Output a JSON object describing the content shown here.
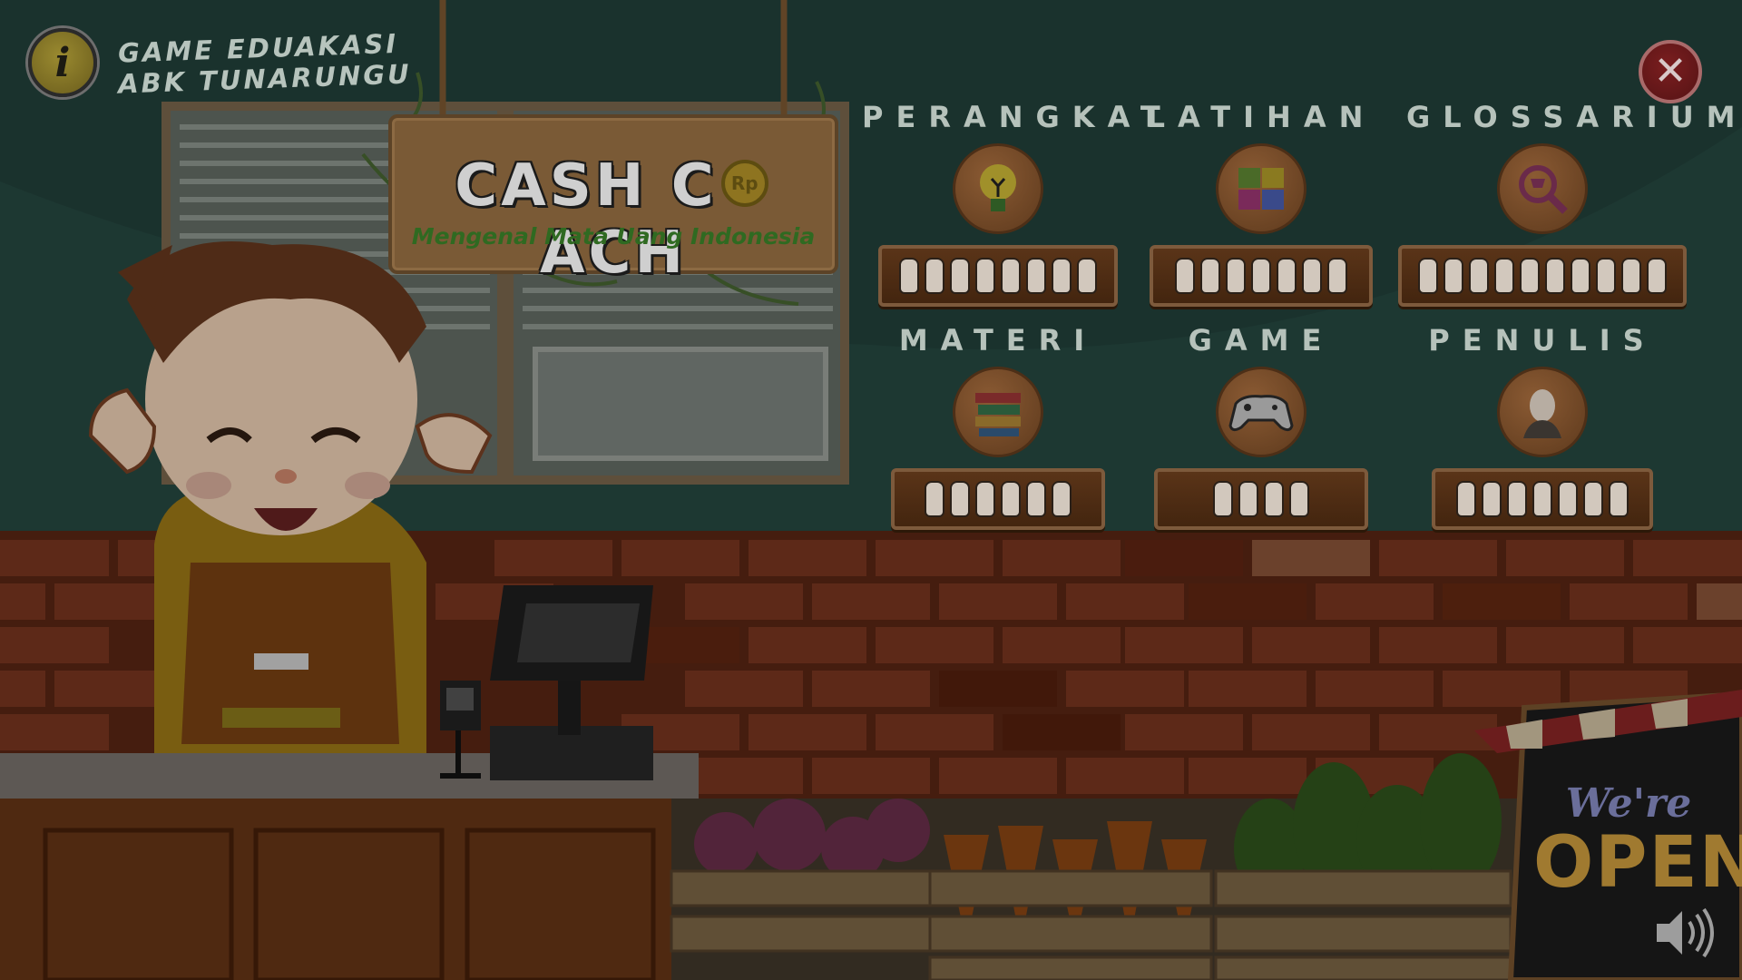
{
  "hud": {
    "info_glyph": "i",
    "title_line1": "GAME EDUAKASI",
    "title_line2": "ABK TUNARUNGU",
    "close_glyph": "✕",
    "sound_icon": "speaker-icon"
  },
  "sign": {
    "title_left": "CASH C",
    "coin_text": "Rp",
    "title_right": "ACH",
    "subtitle": "Mengenal Mata Uang Indonesia"
  },
  "menu": [
    {
      "id": "perangkat",
      "label": "PERANGKAT",
      "icon": "lightbulb-icon",
      "hand_count": 8
    },
    {
      "id": "latihan",
      "label": "LATIHAN",
      "icon": "puzzle-icon",
      "hand_count": 7
    },
    {
      "id": "glossarium",
      "label": "GLOSSARIUM",
      "icon": "magnifier-cart-icon",
      "hand_count": 10
    },
    {
      "id": "materi",
      "label": "MATERI",
      "icon": "books-icon",
      "hand_count": 6
    },
    {
      "id": "game",
      "label": "GAME",
      "icon": "gamepad-icon",
      "hand_count": 4
    },
    {
      "id": "penulis",
      "label": "PENULIS",
      "icon": "author-portrait-icon",
      "hand_count": 7
    }
  ],
  "open_sign": {
    "line1": "We're",
    "line2": "OPEN"
  },
  "colors": {
    "wall": "#1f3a34",
    "brick": "#6b2f1b",
    "wood": "#5b2f14",
    "dim_overlay": "rgba(0,0,0,0.55)"
  }
}
